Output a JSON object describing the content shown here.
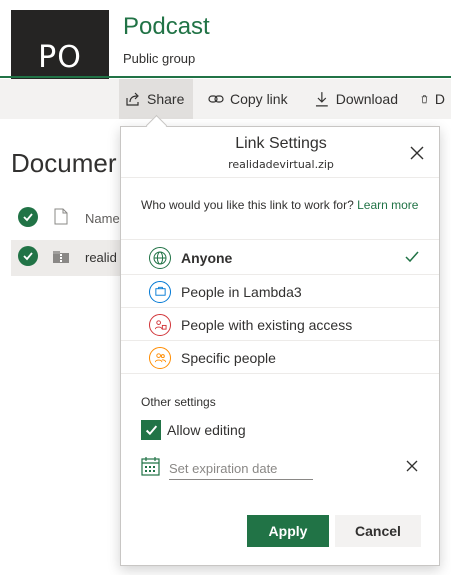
{
  "site": {
    "avatar_initials": "PO",
    "title": "Podcast",
    "subtitle": "Public group"
  },
  "commands": [
    {
      "label": "Share",
      "icon": "share-icon",
      "active": true
    },
    {
      "label": "Copy link",
      "icon": "link-icon"
    },
    {
      "label": "Download",
      "icon": "download-icon"
    },
    {
      "label": "D",
      "icon": "delete-icon"
    }
  ],
  "library": {
    "heading": "Documer",
    "column_name": "Name",
    "row_name": "realid"
  },
  "dialog": {
    "title": "Link Settings",
    "file_name": "realidadevirtual.zip",
    "question": "Who would you like this link to work for?",
    "learn_more": "Learn more",
    "options": [
      {
        "label": "Anyone",
        "icon": "globe-icon",
        "selected": true,
        "color": "#217346"
      },
      {
        "label": "People in Lambda3",
        "icon": "briefcase-icon",
        "selected": false,
        "color": "#0078d4"
      },
      {
        "label": "People with existing access",
        "icon": "people-lock-icon",
        "selected": false,
        "color": "#d13438"
      },
      {
        "label": "Specific people",
        "icon": "people-icon",
        "selected": false,
        "color": "#ff8c00"
      }
    ],
    "other_settings": "Other settings",
    "allow_editing_label": "Allow editing",
    "allow_editing": true,
    "expiration_placeholder": "Set expiration date",
    "apply_label": "Apply",
    "cancel_label": "Cancel"
  },
  "colors": {
    "accent": "#217346",
    "command_bar": "#f3f2f1"
  }
}
